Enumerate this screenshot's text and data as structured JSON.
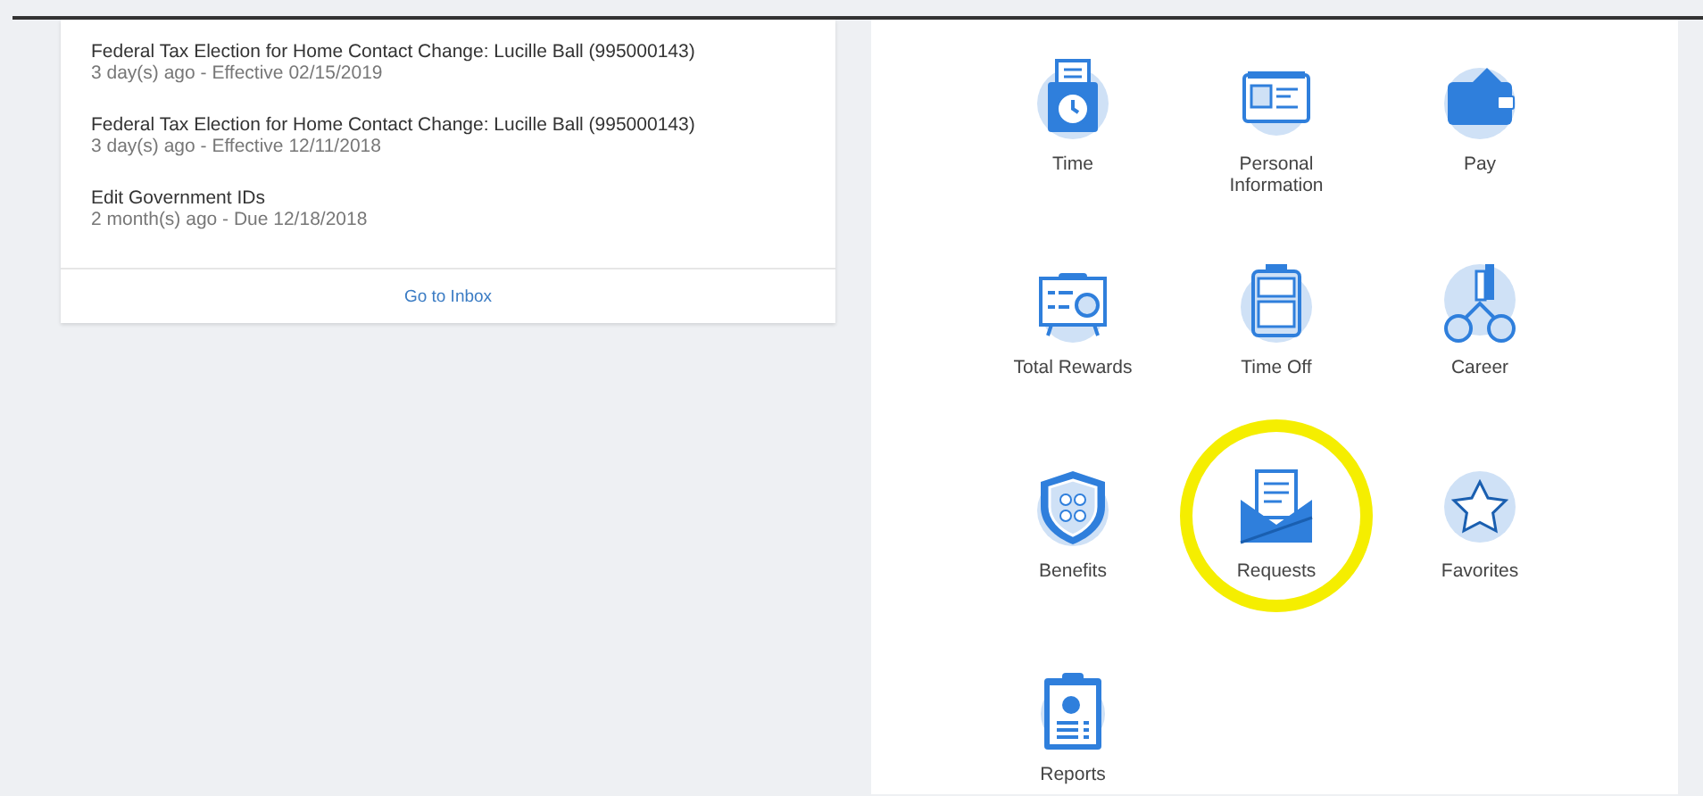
{
  "inbox": {
    "items": [
      {
        "title": "Federal Tax Election for Home Contact Change: Lucille Ball (995000143)",
        "detail": "3 day(s) ago - Effective 02/15/2019"
      },
      {
        "title": "Federal Tax Election for Home Contact Change: Lucille Ball (995000143)",
        "detail": "3 day(s) ago - Effective 12/11/2018"
      },
      {
        "title": "Edit Government IDs",
        "detail": "2 month(s) ago - Due 12/18/2018"
      }
    ],
    "link": "Go to Inbox"
  },
  "apps": [
    {
      "kind": "time",
      "label": "Time",
      "highlighted": false
    },
    {
      "kind": "id-card",
      "label": "Personal Information",
      "highlighted": false
    },
    {
      "kind": "wallet",
      "label": "Pay",
      "highlighted": false
    },
    {
      "kind": "board",
      "label": "Total Rewards",
      "highlighted": false
    },
    {
      "kind": "suitcase",
      "label": "Time Off",
      "highlighted": false
    },
    {
      "kind": "people",
      "label": "Career",
      "highlighted": false
    },
    {
      "kind": "shield",
      "label": "Benefits",
      "highlighted": false
    },
    {
      "kind": "envelope",
      "label": "Requests",
      "highlighted": true
    },
    {
      "kind": "star",
      "label": "Favorites",
      "highlighted": false
    },
    {
      "kind": "clipboard",
      "label": "Reports",
      "highlighted": false
    }
  ]
}
